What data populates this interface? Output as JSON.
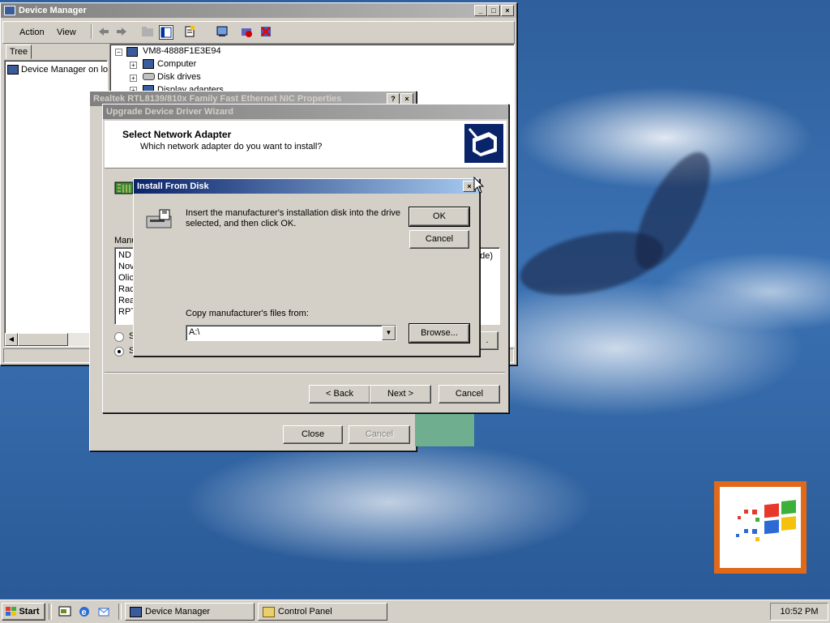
{
  "colors": {
    "desktop": "#3a6ea5",
    "titlebar_active": "#0a246a",
    "titlebar_inactive": "#808080",
    "face": "#d4d0c8"
  },
  "device_manager": {
    "title": "Device Manager",
    "menu": [
      "Action",
      "View"
    ],
    "tree_tab": "Tree",
    "left_item": "Device Manager on lo",
    "tree_root": "VM8-4888F1E3E94",
    "tree_items": [
      "Computer",
      "Disk drives",
      "Display adapters"
    ],
    "toolbar_icons": [
      "back-arrow-icon",
      "forward-arrow-icon",
      "folder-up-icon",
      "details-icon",
      "properties-icon",
      "scan-icon",
      "disable-device-icon",
      "uninstall-icon"
    ]
  },
  "properties_dialog": {
    "title": "Realtek RTL8139/810x Family Fast Ethernet NIC Properties",
    "close_label": "Close",
    "cancel_label": "Cancel"
  },
  "wizard": {
    "title": "Upgrade Device Driver Wizard",
    "heading": "Select Network Adapter",
    "subheading": "Which network adapter do you want to install?",
    "manufacturers_label": "Manu",
    "list_items": [
      "ND",
      "Nov",
      "Olic",
      "Rac",
      "Rea",
      "RPT"
    ],
    "right_fragment": "ode)",
    "radio1": "S",
    "radio2": "S",
    "right_btn_fragment": ".",
    "back_label": "< Back",
    "next_label": "Next >",
    "cancel_label": "Cancel"
  },
  "install_disk": {
    "title": "Install From Disk",
    "message_line1": "Insert the manufacturer's installation disk into the drive",
    "message_line2": "selected, and then click OK.",
    "ok_label": "OK",
    "cancel_label": "Cancel",
    "copy_label": "Copy manufacturer's files from:",
    "path_value": "A:\\",
    "browse_label": "Browse..."
  },
  "taskbar": {
    "start_label": "Start",
    "quick_launch": [
      "show-desktop-icon",
      "internet-explorer-icon",
      "outlook-express-icon"
    ],
    "tasks": [
      "Device Manager",
      "Control Panel"
    ],
    "clock": "10:52 PM"
  }
}
